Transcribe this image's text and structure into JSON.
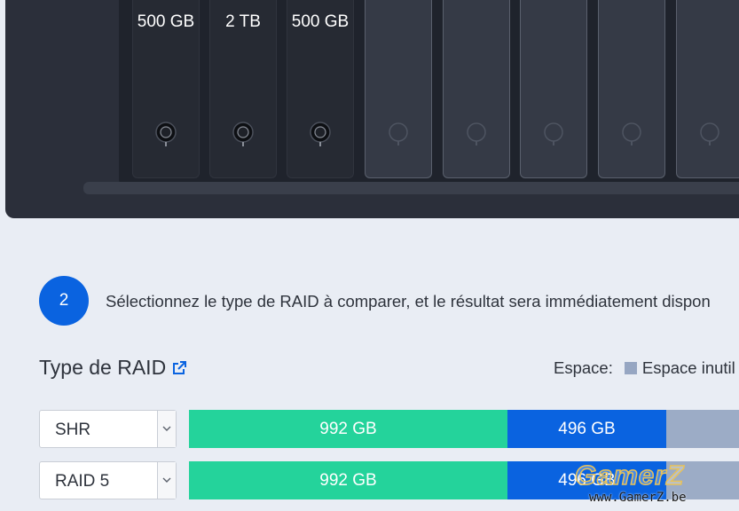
{
  "nas": {
    "bays": [
      {
        "label": "500 GB",
        "filled": true
      },
      {
        "label": "2 TB",
        "filled": true
      },
      {
        "label": "500 GB",
        "filled": true
      },
      {
        "label": "",
        "filled": false
      },
      {
        "label": "",
        "filled": false
      },
      {
        "label": "",
        "filled": false
      },
      {
        "label": "",
        "filled": false
      },
      {
        "label": "",
        "filled": false
      }
    ]
  },
  "step": {
    "number": "2",
    "text": "Sélectionnez le type de RAID à comparer, et le résultat sera immédiatement dispon"
  },
  "section": {
    "title": "Type de RAID",
    "icon": "external-link-icon"
  },
  "legend": {
    "label": "Espace:",
    "item_label": "Espace inutil",
    "item_color": "#96a6c2"
  },
  "rows": [
    {
      "raid_type": "SHR",
      "segments": [
        {
          "label": "992 GB",
          "color": "#24d39b"
        },
        {
          "label": "496 GB",
          "color": "#0a63e0"
        },
        {
          "label": "",
          "color": "#9cacc6"
        }
      ]
    },
    {
      "raid_type": "RAID 5",
      "segments": [
        {
          "label": "992 GB",
          "color": "#24d39b"
        },
        {
          "label": "496 GB",
          "color": "#0a63e0"
        },
        {
          "label": "",
          "color": "#9cacc6"
        }
      ]
    }
  ],
  "watermark": {
    "main": "GamerZ",
    "sub": "www.GamerZ.be"
  }
}
